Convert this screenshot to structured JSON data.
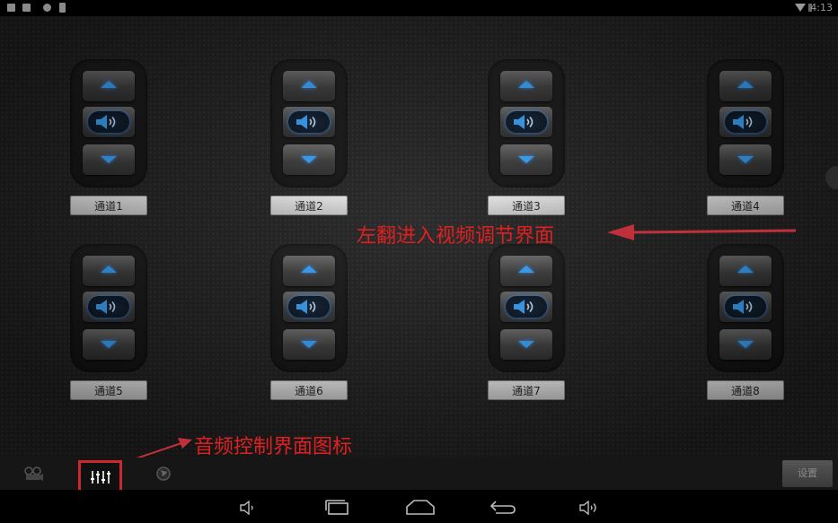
{
  "status_bar": {
    "time": "4:13",
    "notification_icons": [
      "android-notification-icon",
      "image-notification-icon",
      "shield-notification-icon",
      "sd-card-notification-icon"
    ]
  },
  "channels": [
    {
      "label": "通道1"
    },
    {
      "label": "通道2"
    },
    {
      "label": "通道3"
    },
    {
      "label": "通道4"
    },
    {
      "label": "通道5"
    },
    {
      "label": "通道6"
    },
    {
      "label": "通道7"
    },
    {
      "label": "通道8"
    }
  ],
  "annotations": {
    "swipe_hint": "左翻进入视频调节界面",
    "audio_icon_hint": "音频控制界面图标"
  },
  "bottom_bar": {
    "tabs": [
      {
        "icon": "camera-icon",
        "state": "inactive"
      },
      {
        "icon": "audio-mixer-icon",
        "state": "active"
      },
      {
        "icon": "globe-icon",
        "state": "inactive"
      }
    ],
    "settings_label": "设置"
  },
  "nav_bar": {
    "buttons": [
      "volume-down-icon",
      "recent-apps-icon",
      "home-icon",
      "back-icon",
      "volume-up-icon"
    ]
  },
  "colors": {
    "accent": "#3aa6ff",
    "annotation": "#e02020",
    "highlight_box": "#c8282e"
  }
}
